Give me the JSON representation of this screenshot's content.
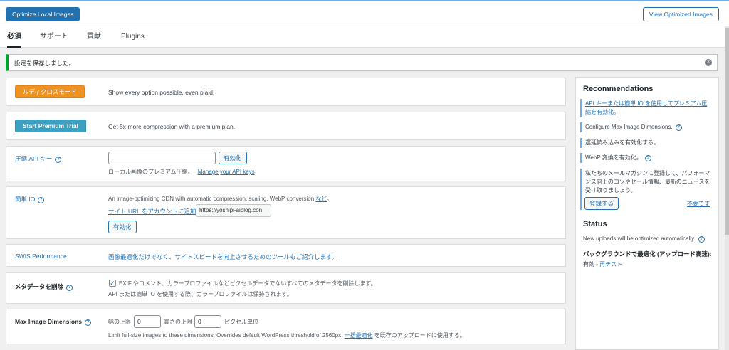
{
  "topbar": {
    "optimize_local_label": "Optimize Local Images",
    "view_optimized_label": "View Optimized Images"
  },
  "tabs": [
    {
      "label": "必須"
    },
    {
      "label": "サポート"
    },
    {
      "label": "貢献"
    },
    {
      "label": "Plugins"
    }
  ],
  "notice": {
    "text": "設定を保存しました。"
  },
  "ludicrous": {
    "button_label": "ルディクロスモード",
    "desc": "Show every option possible, even plaid."
  },
  "premium": {
    "button_label": "Start Premium Trial",
    "desc": "Get 5x more compression with a premium plan."
  },
  "api_key": {
    "label": "圧縮 API キー",
    "input_value": "",
    "activate_label": "有効化",
    "desc": "ローカル画像のプレミアム圧縮。",
    "manage_link": "Manage your API keys"
  },
  "easy_io": {
    "label": "簡単 IO",
    "desc": "An image-optimizing CDN with automatic compression, scaling, WebP conversion",
    "more_link": "など",
    "desc_end": "。",
    "site_link": "サイト URL をアカウントに追加",
    "site_url": "https://yoshipi-aiblog.con",
    "activate_label": "有効化"
  },
  "swis": {
    "label": "SWIS Performance",
    "link": "画像最適化だけでなく、サイトスピードを向上させるためのツールもご紹介します。"
  },
  "metadata": {
    "label": "メタデータを削除",
    "checked": true,
    "check_mark": "✓",
    "desc": "EXIF やコメント、カラープロファイルなどピクセルデータでないすべてのメタデータを削除します。",
    "note": "API または簡単 IO を使用する際、カラープロファイルは保持されます。"
  },
  "max_dims": {
    "label": "Max Image Dimensions",
    "width_label": "幅の上限",
    "width_value": "0",
    "height_label": "高さの上限",
    "height_value": "0",
    "unit": "ピクセル単位",
    "desc_pre": "Limit full-size images to these dimensions. Overrides default WordPress threshold of 2560px.",
    "bulk_link": "一括最適化",
    "desc_post": "を既存のアップロードに使用する。"
  },
  "sidebar": {
    "rec_title": "Recommendations",
    "rec_api_link": "API キーまたは簡単 IO を使用してプレミアム圧縮を有効化。",
    "rec_max_dims": "Configure Max Image Dimensions.",
    "rec_lazy": "遅延読み込みを有効化する。",
    "rec_webp": "WebP 変換を有効化。",
    "rec_newsletter": "私たちのメールマガジンに登録して、パフォーマンス向上のコツやセール情報、最新のニュースを受け取りましょう。",
    "subscribe_label": "登録する",
    "no_thanks_link": "不要です",
    "status_title": "Status",
    "status_text": "New uploads will be optimized automatically.",
    "bg_title": "バックグラウンドで最適化 (アップロード高速):",
    "bg_status": "有効 -",
    "retest_link": "再テスト"
  },
  "help_glyph": "?",
  "close_glyph": "×",
  "colors": {
    "primary": "#2271b1",
    "success": "#00a32a",
    "orange": "#f0921f",
    "teal": "#3ca0c2",
    "rec_border": "#72aee6"
  }
}
